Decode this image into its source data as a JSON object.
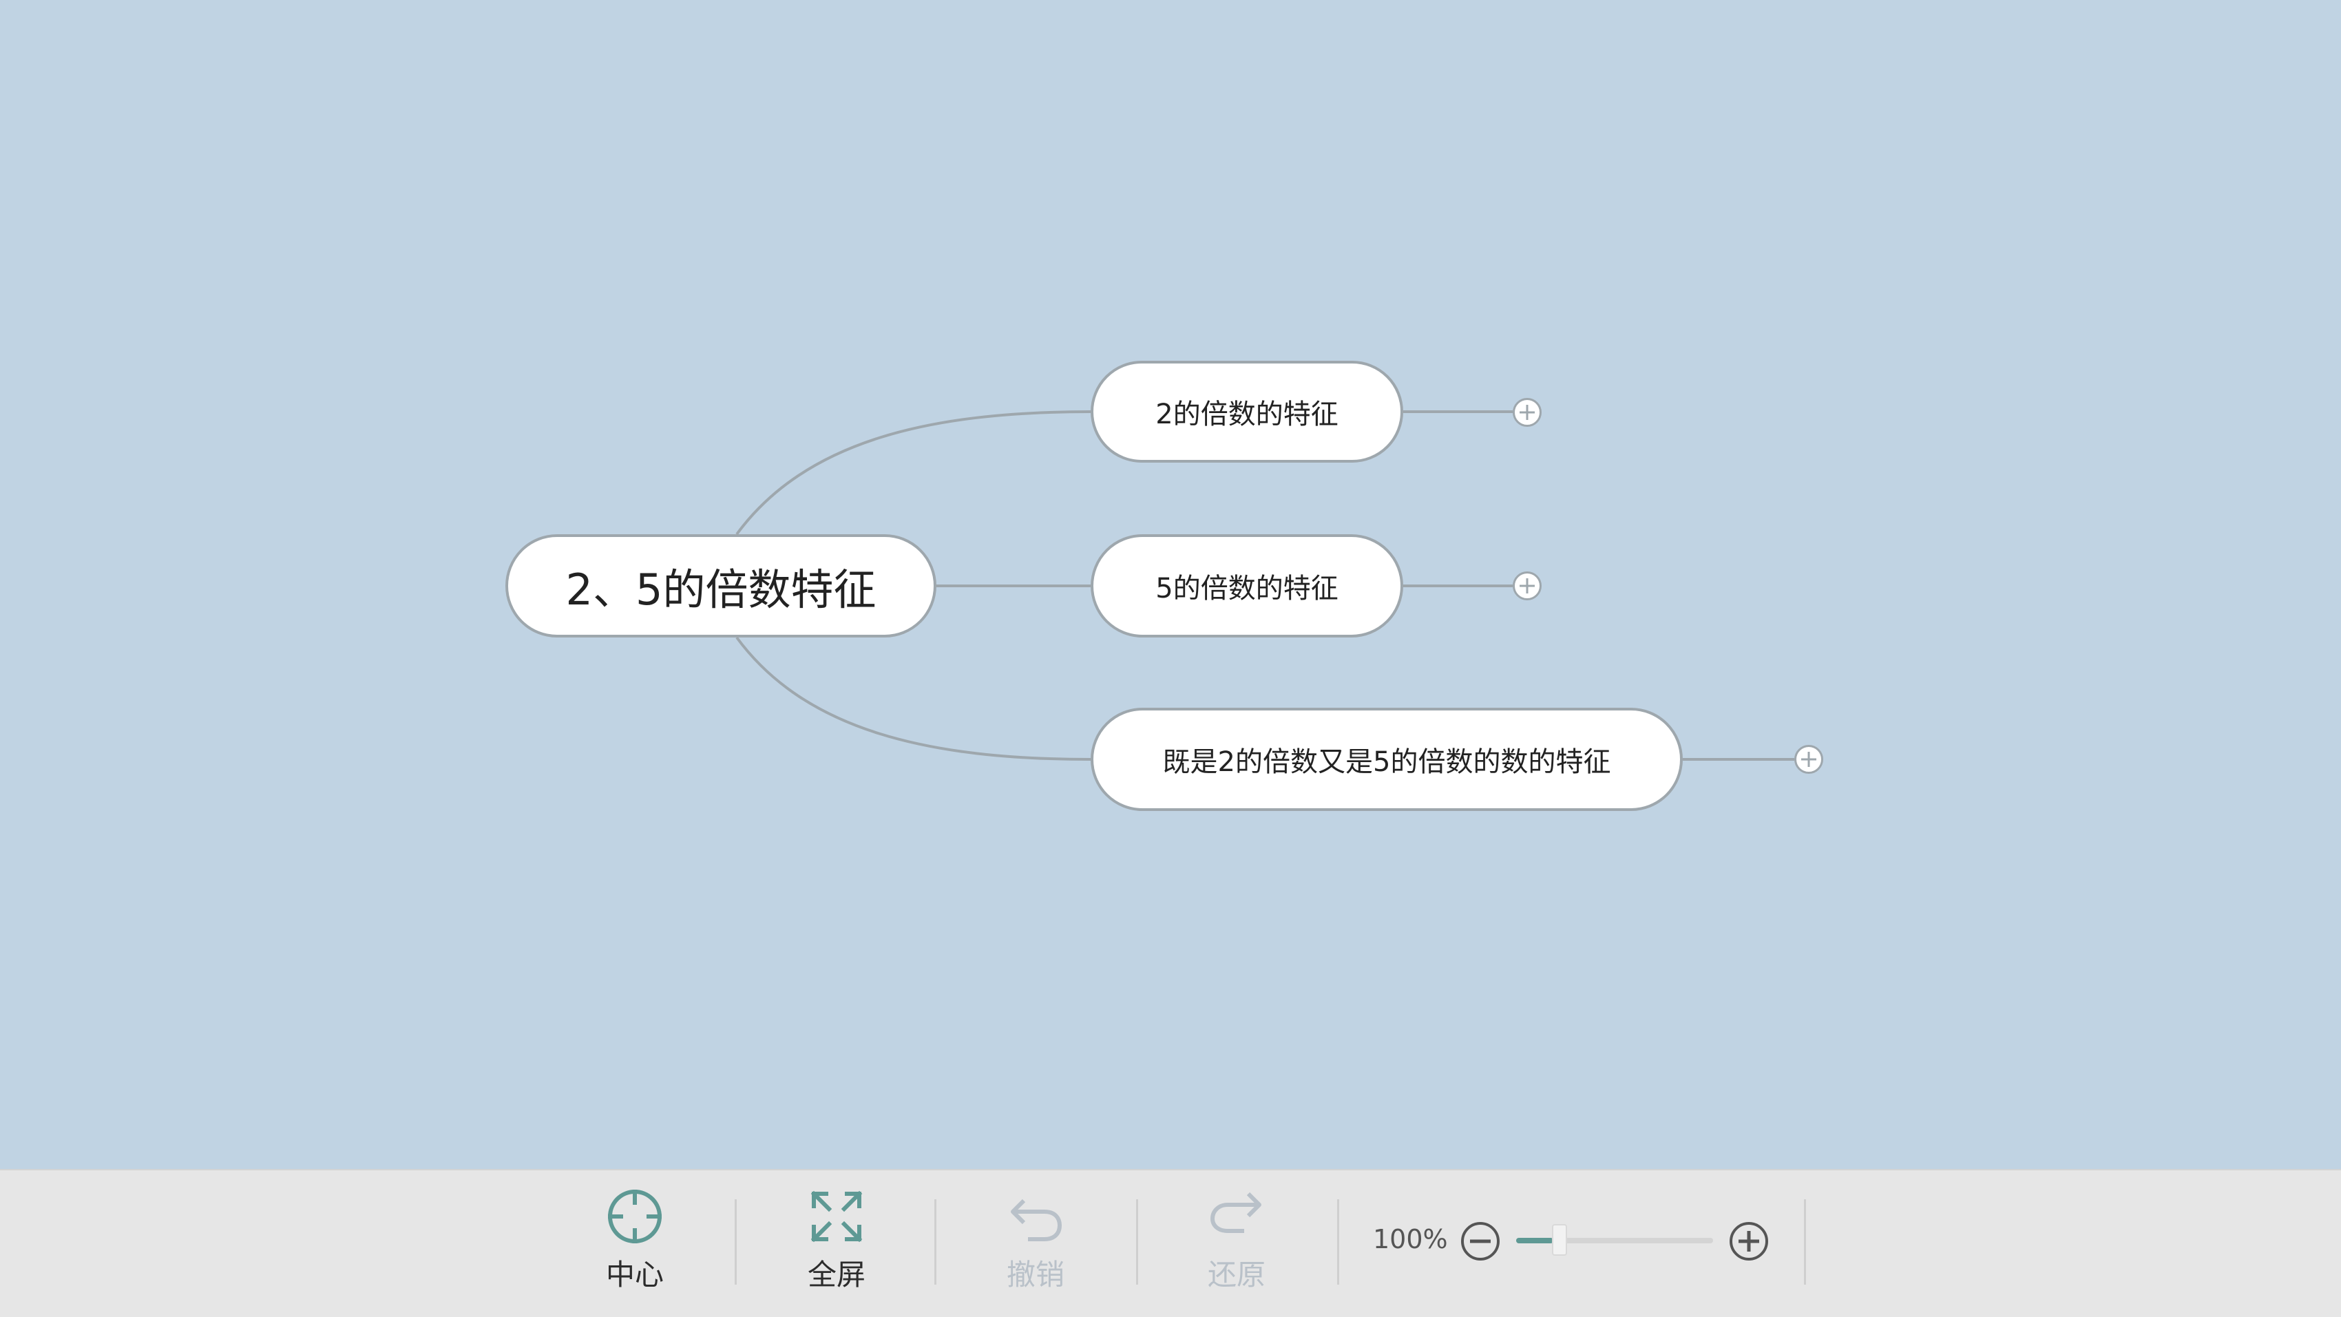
{
  "mindmap": {
    "root": {
      "label": "2、5的倍数特征"
    },
    "children": [
      {
        "label": "2的倍数的特征",
        "collapsed": true
      },
      {
        "label": "5的倍数的特征",
        "collapsed": true
      },
      {
        "label": "既是2的倍数又是5的倍数的数的特征",
        "collapsed": true
      }
    ]
  },
  "toolbar": {
    "center": {
      "label": "中心",
      "icon": "crosshair-icon",
      "enabled": true
    },
    "fullscreen": {
      "label": "全屏",
      "icon": "expand-arrows-icon",
      "enabled": true
    },
    "undo": {
      "label": "撤销",
      "icon": "undo-arrow-icon",
      "enabled": false
    },
    "redo": {
      "label": "还原",
      "icon": "redo-arrow-icon",
      "enabled": false
    },
    "zoom": {
      "level_text": "100%",
      "slider_fraction": 0.19
    }
  },
  "colors": {
    "canvas_background": "#c0d3e3",
    "toolbar_background": "#e6e6e6",
    "node_border": "#9ea7ad",
    "accent": "#5e9994"
  }
}
